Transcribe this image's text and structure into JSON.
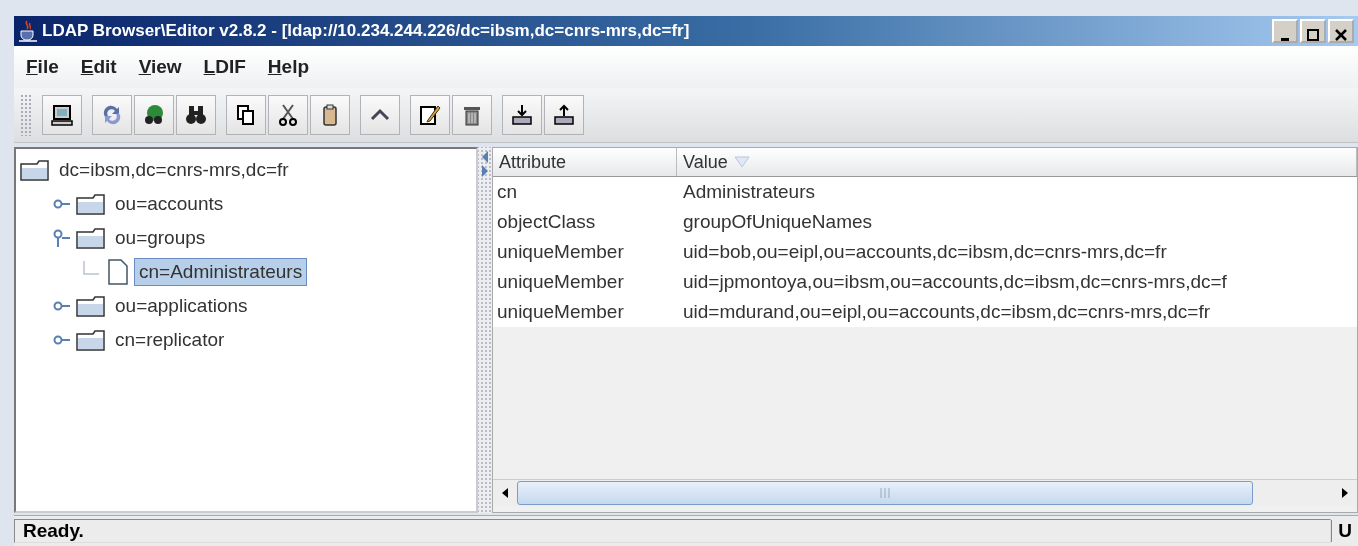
{
  "window": {
    "title": "LDAP Browser\\Editor v2.8.2 - [ldap://10.234.244.226/dc=ibsm,dc=cnrs-mrs,dc=fr]"
  },
  "menu": [
    "File",
    "Edit",
    "View",
    "LDIF",
    "Help"
  ],
  "tree": [
    {
      "label": "dc=ibsm,dc=cnrs-mrs,dc=fr",
      "kind": "folder",
      "selected": false,
      "children": [
        {
          "label": "ou=accounts",
          "kind": "folder",
          "expanded": false,
          "selected": false
        },
        {
          "label": "ou=groups",
          "kind": "folder",
          "expanded": true,
          "selected": false,
          "children": [
            {
              "label": "cn=Administrateurs",
              "kind": "leaf",
              "selected": true
            }
          ]
        },
        {
          "label": "ou=applications",
          "kind": "folder",
          "expanded": false,
          "selected": false
        },
        {
          "label": "cn=replicator",
          "kind": "folder",
          "expanded": false,
          "selected": false
        }
      ]
    }
  ],
  "table": {
    "columns": [
      "Attribute",
      "Value"
    ],
    "rows": [
      [
        "cn",
        "Administrateurs"
      ],
      [
        "objectClass",
        "groupOfUniqueNames"
      ],
      [
        "uniqueMember",
        "uid=bob,ou=eipl,ou=accounts,dc=ibsm,dc=cnrs-mrs,dc=fr"
      ],
      [
        "uniqueMember",
        "uid=jpmontoya,ou=ibsm,ou=accounts,dc=ibsm,dc=cnrs-mrs,dc=f"
      ],
      [
        "uniqueMember",
        "uid=mdurand,ou=eipl,ou=accounts,dc=ibsm,dc=cnrs-mrs,dc=fr"
      ]
    ]
  },
  "status_bar": {
    "message": "Ready.",
    "indicator": "U"
  }
}
